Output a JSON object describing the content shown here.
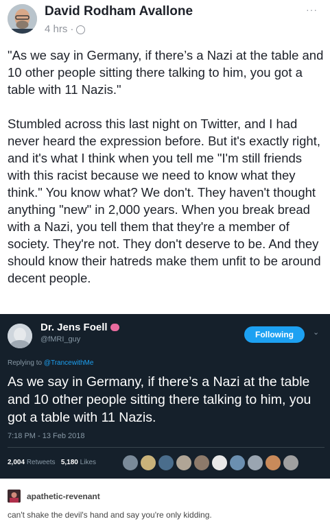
{
  "post": {
    "author": "David Rodham Avallone",
    "time": "4 hrs",
    "separator": "·",
    "more_icon": "···",
    "paragraphs": [
      "\"As we say in Germany, if there’s a Nazi at the table and 10 other people sitting there talking to him, you got a table with 11 Nazis.\"",
      "Stumbled across this last night on Twitter, and I had never heard the expression before. But it's exactly right, and it's what I think when you tell me \"I'm still friends with this racist because we need to know what they think.\" You know what? We don't. They haven't thought anything \"new\" in 2,000 years. When you break bread with a Nazi, you tell them that they're a member of society. They're not. They don't deserve to be. And they should know their hatreds make them unfit to be around decent people."
    ]
  },
  "tweet": {
    "name": "Dr. Jens Foell",
    "handle": "@fMRI_guy",
    "follow_label": "Following",
    "chevron": "⌄",
    "replying_prefix": "Replying to ",
    "replying_to": "@TrancewithMe",
    "text": "As we say in Germany, if there’s a Nazi at the table and 10 other people sitting there talking to him, you got a table with 11 Nazis.",
    "timestamp": "7:18 PM - 13 Feb 2018",
    "retweets_count": "2,004",
    "retweets_label": "Retweets",
    "likes_count": "5,180",
    "likes_label": "Likes",
    "liker_colors": [
      "#7a8a99",
      "#c9b27a",
      "#4a6d8c",
      "#b0a596",
      "#8d7a6a",
      "#e8e8e8",
      "#6b8fb0",
      "#9aa5b1",
      "#c98a5a",
      "#a0a0a0"
    ]
  },
  "reblog": {
    "username": "apathetic-revenant",
    "comment": "can't shake the devil's hand and say you're only kidding."
  }
}
